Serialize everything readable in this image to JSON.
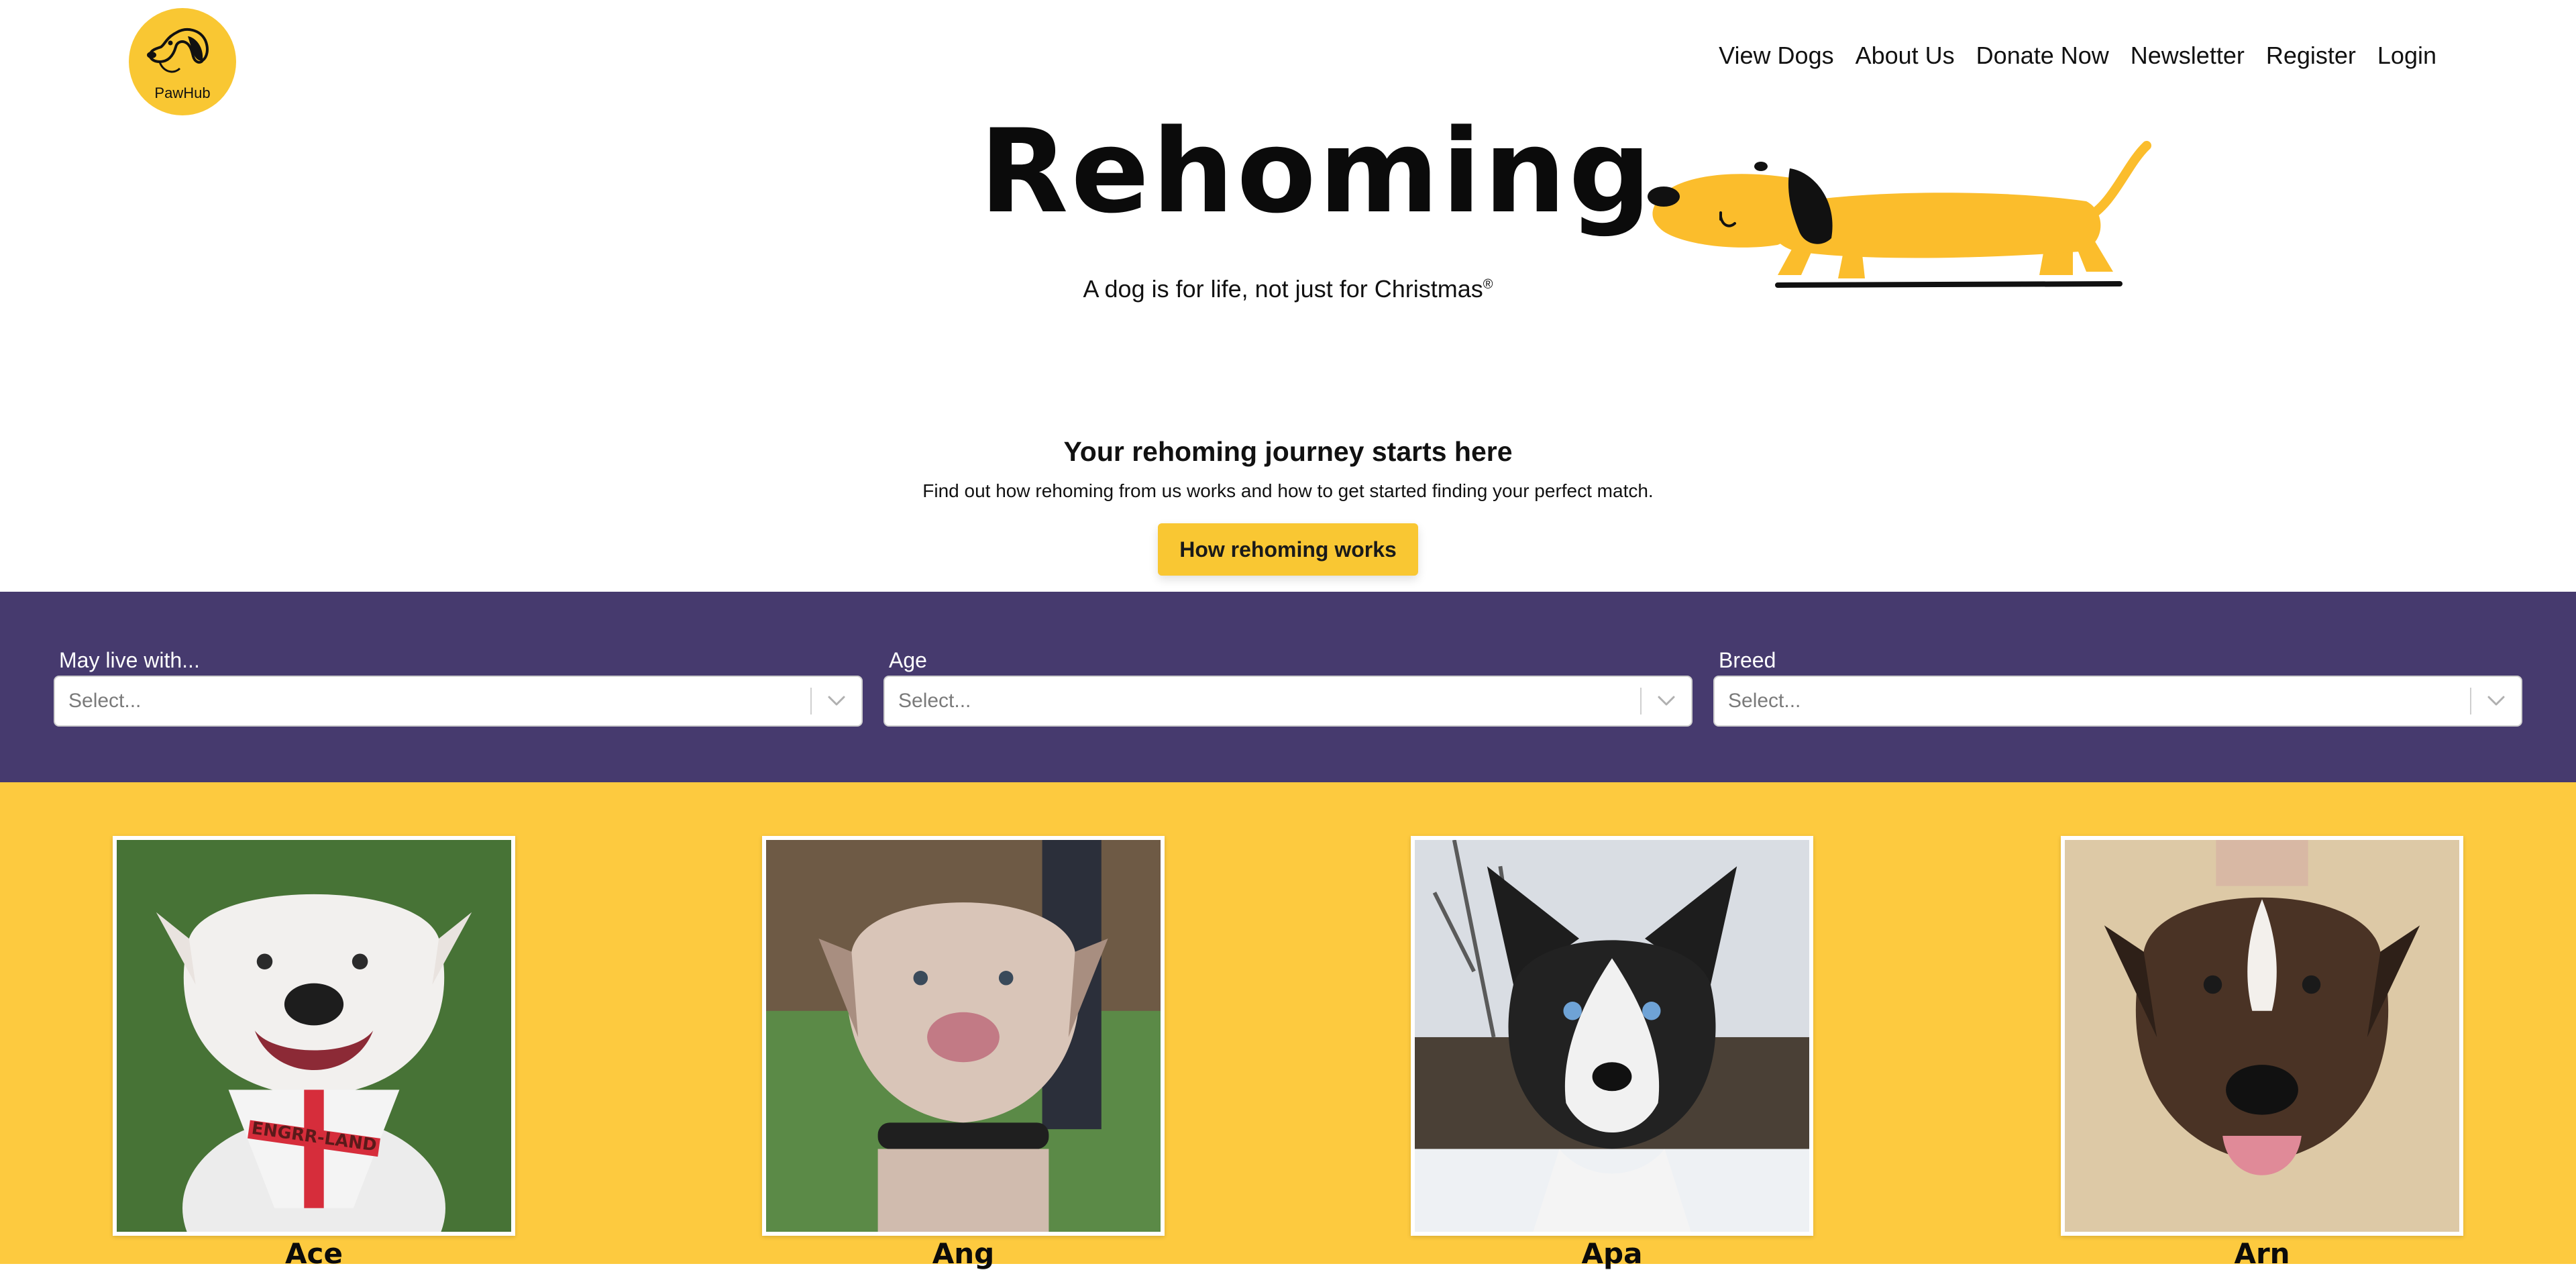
{
  "brand": {
    "logo_text": "PawHub"
  },
  "nav": [
    "View Dogs",
    "About Us",
    "Donate Now",
    "Newsletter",
    "Register",
    "Login"
  ],
  "hero": {
    "title": "Rehoming",
    "tagline": "A dog is for life, not just for Christmas",
    "tagline_mark": "®"
  },
  "intro": {
    "heading": "Your rehoming journey starts here",
    "text": "Find out how rehoming from us works and how to get started finding your perfect match.",
    "button": "How rehoming works"
  },
  "filters": [
    {
      "label": "May live with...",
      "placeholder": "Select..."
    },
    {
      "label": "Age",
      "placeholder": "Select..."
    },
    {
      "label": "Breed",
      "placeholder": "Select..."
    }
  ],
  "dogs": [
    {
      "name": "Ace",
      "bandana_text": "ENGRR-LAND"
    },
    {
      "name": "Ang"
    },
    {
      "name": "Apa"
    },
    {
      "name": "Arn"
    }
  ],
  "colors": {
    "brand_yellow": "#f9c733",
    "filter_purple": "#463a6e",
    "grid_yellow": "#fdca3f"
  }
}
